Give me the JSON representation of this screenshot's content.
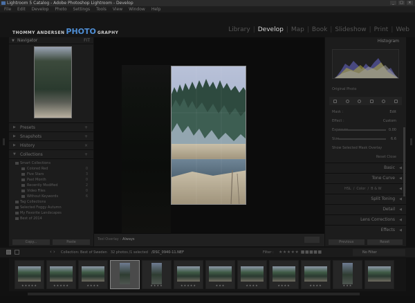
{
  "window": {
    "title": "Lightroom 5 Catalog - Adobe Photoshop Lightroom - Develop",
    "minimize": "_",
    "maximize": "□",
    "close": "×"
  },
  "menu": [
    "File",
    "Edit",
    "Develop",
    "Photo",
    "Settings",
    "Tools",
    "View",
    "Window",
    "Help"
  ],
  "identity_plate": {
    "part1": "THOMMY ANDERSEN",
    "part2": "PHOTO",
    "part3": "GRAPHY"
  },
  "modules": [
    "Library",
    "Develop",
    "Map",
    "Book",
    "Slideshow",
    "Print",
    "Web"
  ],
  "left_panel": {
    "navigator": {
      "title": "Navigator",
      "zoom": "FIT"
    },
    "sections": [
      "Presets",
      "Snapshots",
      "History",
      "Collections"
    ],
    "collections": [
      {
        "name": "Smart Collections",
        "count": ""
      },
      {
        "name": "Colored Red",
        "count": "0"
      },
      {
        "name": "Five Stars",
        "count": "3"
      },
      {
        "name": "Past Month",
        "count": "0"
      },
      {
        "name": "Recently Modified",
        "count": "2"
      },
      {
        "name": "Video Files",
        "count": "0"
      },
      {
        "name": "Without Keywords",
        "count": "6"
      },
      {
        "name": "Tag Collections",
        "count": ""
      },
      {
        "name": "Selected Foggy Autumn",
        "count": ""
      },
      {
        "name": "My Favorite Landscapes",
        "count": ""
      },
      {
        "name": "Best of 2014",
        "count": ""
      }
    ],
    "buttons": {
      "copy": "Copy...",
      "paste": "Paste"
    }
  },
  "toolbar": {
    "label": "Tool Overlay :",
    "value": "Always",
    "done": "Done"
  },
  "right_panel": {
    "histogram_title": "Histogram",
    "original_photo": "Original Photo",
    "mask": {
      "mode_label": "Mask :",
      "mode_value": "Edit",
      "effect_label": "Effect :",
      "effect_value": "Custom",
      "exposure_label": "Exposure",
      "exposure_value": "0.00",
      "brush_label": "Size",
      "brush_value": "6.6",
      "show_mask": "Show Selected Mask Overlay",
      "reset": "Reset",
      "close": "Close"
    },
    "sections": [
      "Basic",
      "Tone Curve",
      "HSL",
      "Split Toning",
      "Detail",
      "Lens Corrections",
      "Effects"
    ],
    "hsl_tabs": [
      "HSL",
      "Color",
      "B & W"
    ],
    "buttons": {
      "previous": "Previous",
      "reset": "Reset"
    }
  },
  "filmstrip_bar": {
    "source": "Collection: Best of Sweden",
    "count": "32 photos /1 selected",
    "file": "/DSC_0940-11.NEF",
    "filter_label": "Filter :",
    "filter_value": "No Filter"
  },
  "filmstrip": {
    "thumbnails": [
      {
        "rating": "★★★★★",
        "selected": false,
        "portrait": false
      },
      {
        "rating": "★★★★★",
        "selected": false,
        "portrait": false
      },
      {
        "rating": "★★★★",
        "selected": false,
        "portrait": false
      },
      {
        "rating": "",
        "selected": true,
        "portrait": true
      },
      {
        "rating": "★★★★",
        "selected": false,
        "portrait": true
      },
      {
        "rating": "★★★★★",
        "selected": false,
        "portrait": false
      },
      {
        "rating": "★★★",
        "selected": false,
        "portrait": false
      },
      {
        "rating": "★★★★",
        "selected": false,
        "portrait": false
      },
      {
        "rating": "★★★★",
        "selected": false,
        "portrait": false
      },
      {
        "rating": "★★★★",
        "selected": false,
        "portrait": false
      },
      {
        "rating": "★★★",
        "selected": false,
        "portrait": true
      },
      {
        "rating": "",
        "selected": false,
        "portrait": false
      }
    ]
  },
  "colors": {
    "accent": "#4f8fd6",
    "panel": "#1c1c1c",
    "background": "#111111",
    "active_module": "#d8d8d8"
  }
}
